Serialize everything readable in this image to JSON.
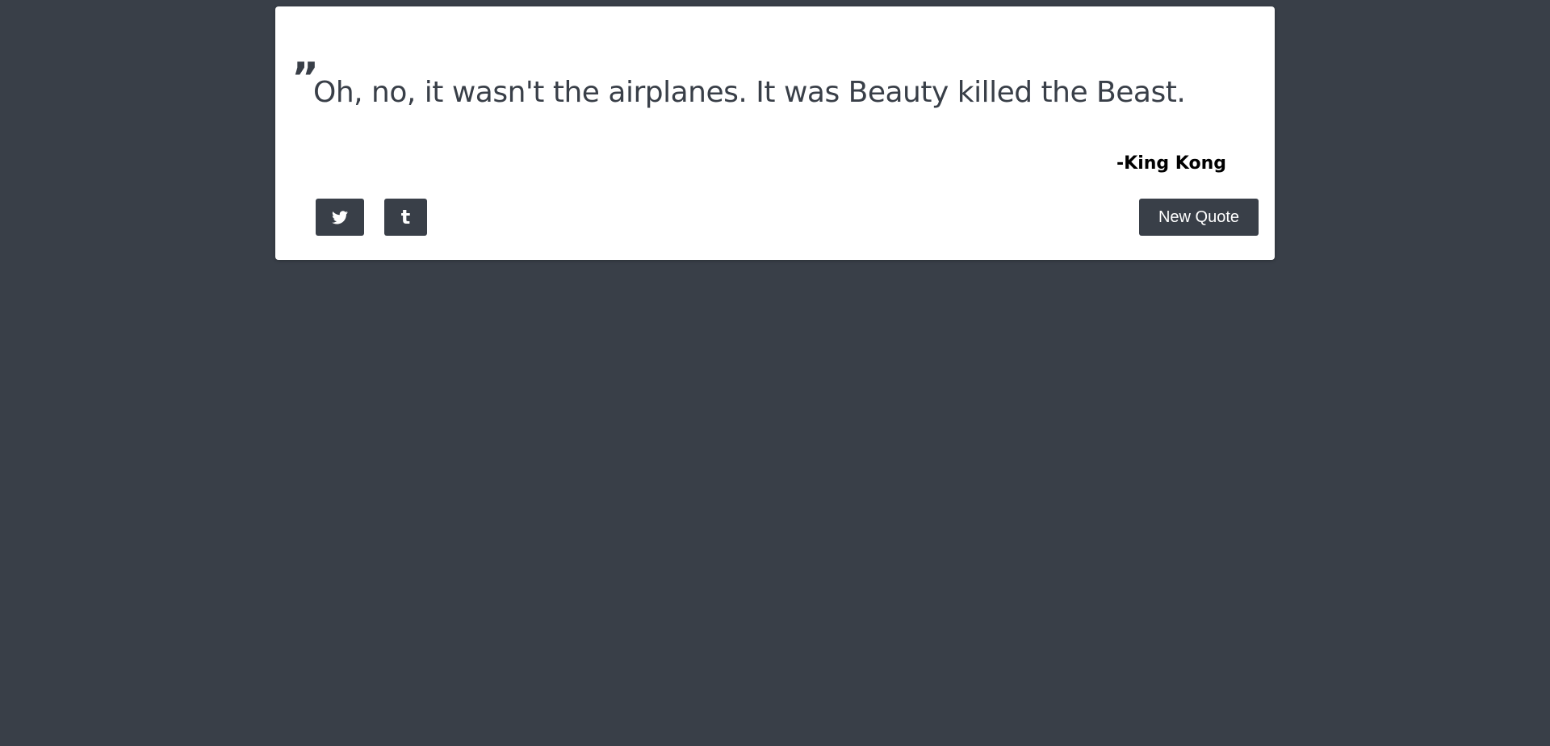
{
  "quote": {
    "mark": "”",
    "text": "Oh, no, it wasn't the airplanes. It was Beauty killed the Beast.",
    "author": "-King Kong"
  },
  "actions": {
    "twitter_icon": "twitter-icon",
    "tumblr_icon": "tumblr-icon",
    "tumblr_glyph": "t",
    "new_quote_label": "New Quote"
  },
  "colors": {
    "background": "#393f48",
    "card": "#ffffff",
    "button": "#393f48",
    "button_text": "#ffffff"
  }
}
